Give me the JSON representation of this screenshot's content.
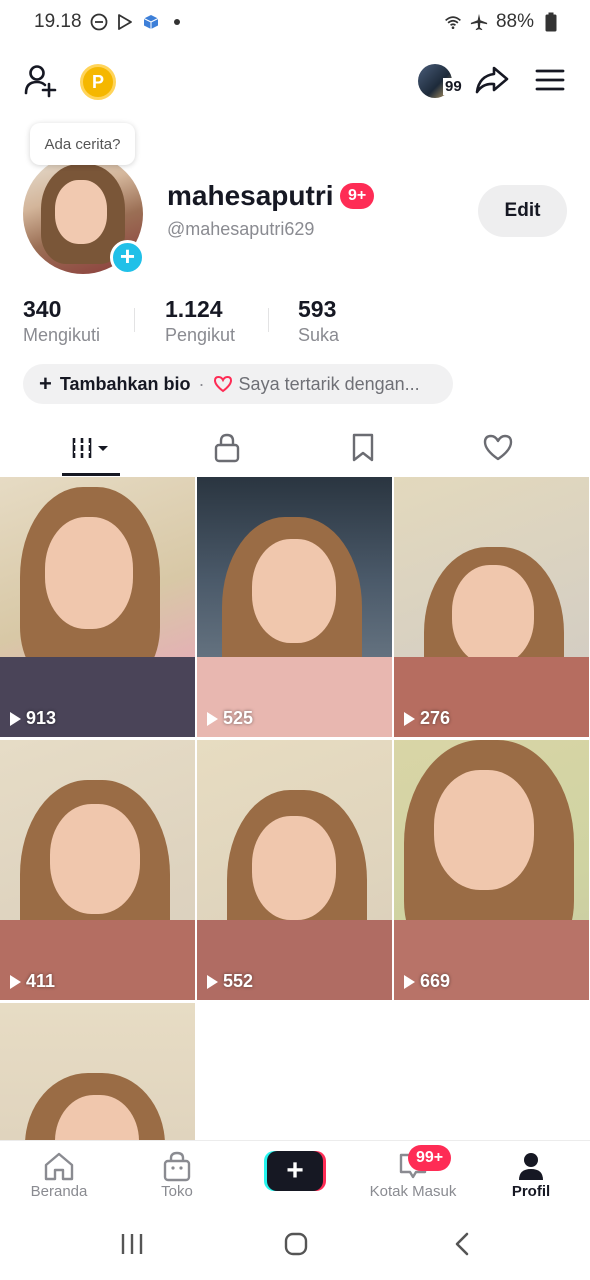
{
  "status_bar": {
    "time": "19.18",
    "battery": "88%"
  },
  "tooltip": {
    "text": "Ada cerita?"
  },
  "profile": {
    "username": "mahesaputri",
    "name_badge": "9+",
    "handle": "@mahesaputri629",
    "edit_label": "Edit",
    "friends_count": "99"
  },
  "stats": [
    {
      "value": "340",
      "label": "Mengikuti"
    },
    {
      "value": "1.124",
      "label": "Pengikut"
    },
    {
      "value": "593",
      "label": "Suka"
    }
  ],
  "bio": {
    "add_label": "Tambahkan bio",
    "separator": "·",
    "interest_label": "Saya tertarik dengan..."
  },
  "tabs": [
    {
      "icon": "video-grid-icon",
      "active": true
    },
    {
      "icon": "lock-icon",
      "active": false
    },
    {
      "icon": "bookmark-icon",
      "active": false
    },
    {
      "icon": "heart-icon",
      "active": false
    }
  ],
  "videos": [
    {
      "views": "913"
    },
    {
      "views": "525"
    },
    {
      "views": "276"
    },
    {
      "views": "411"
    },
    {
      "views": "552"
    },
    {
      "views": "669"
    },
    {
      "views": ""
    }
  ],
  "bottom_nav": {
    "items": [
      {
        "label": "Beranda",
        "icon": "home-icon"
      },
      {
        "label": "Toko",
        "icon": "shop-bag-icon"
      },
      {
        "label": "",
        "icon": "create-plus-icon"
      },
      {
        "label": "Kotak Masuk",
        "icon": "inbox-icon"
      },
      {
        "label": "Profil",
        "icon": "profile-icon"
      }
    ],
    "inbox_badge": "99+"
  },
  "colors": {
    "accent_red": "#fe2c55",
    "accent_cyan": "#25f4ee",
    "text_primary": "#161823",
    "text_secondary": "#8a8b91"
  }
}
